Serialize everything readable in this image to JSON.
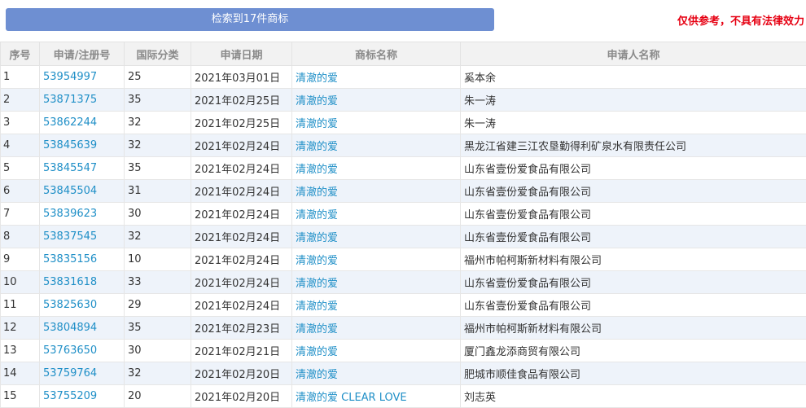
{
  "header": {
    "result_button_label": "检索到17件商标",
    "disclaimer": "仅供参考，不具有法律效力"
  },
  "table": {
    "columns": [
      "序号",
      "申请/注册号",
      "国际分类",
      "申请日期",
      "商标名称",
      "申请人名称"
    ],
    "rows": [
      {
        "no": "1",
        "reg_no": "53954997",
        "class": "25",
        "date": "2021年03月01日",
        "mark": "清澈的爱",
        "applicant": "奚本余"
      },
      {
        "no": "2",
        "reg_no": "53871375",
        "class": "35",
        "date": "2021年02月25日",
        "mark": "清澈的爱",
        "applicant": "朱一涛"
      },
      {
        "no": "3",
        "reg_no": "53862244",
        "class": "32",
        "date": "2021年02月25日",
        "mark": "清澈的爱",
        "applicant": "朱一涛"
      },
      {
        "no": "4",
        "reg_no": "53845639",
        "class": "32",
        "date": "2021年02月24日",
        "mark": "清澈的爱",
        "applicant": "黑龙江省建三江农垦勤得利矿泉水有限责任公司"
      },
      {
        "no": "5",
        "reg_no": "53845547",
        "class": "35",
        "date": "2021年02月24日",
        "mark": "清澈的爱",
        "applicant": "山东省壹份爱食品有限公司"
      },
      {
        "no": "6",
        "reg_no": "53845504",
        "class": "31",
        "date": "2021年02月24日",
        "mark": "清澈的爱",
        "applicant": "山东省壹份爱食品有限公司"
      },
      {
        "no": "7",
        "reg_no": "53839623",
        "class": "30",
        "date": "2021年02月24日",
        "mark": "清澈的爱",
        "applicant": "山东省壹份爱食品有限公司"
      },
      {
        "no": "8",
        "reg_no": "53837545",
        "class": "32",
        "date": "2021年02月24日",
        "mark": "清澈的爱",
        "applicant": "山东省壹份爱食品有限公司"
      },
      {
        "no": "9",
        "reg_no": "53835156",
        "class": "10",
        "date": "2021年02月24日",
        "mark": "清澈的爱",
        "applicant": "福州市帕柯斯新材料有限公司"
      },
      {
        "no": "10",
        "reg_no": "53831618",
        "class": "33",
        "date": "2021年02月24日",
        "mark": "清澈的爱",
        "applicant": "山东省壹份爱食品有限公司"
      },
      {
        "no": "11",
        "reg_no": "53825630",
        "class": "29",
        "date": "2021年02月24日",
        "mark": "清澈的爱",
        "applicant": "山东省壹份爱食品有限公司"
      },
      {
        "no": "12",
        "reg_no": "53804894",
        "class": "35",
        "date": "2021年02月23日",
        "mark": "清澈的爱",
        "applicant": "福州市帕柯斯新材料有限公司"
      },
      {
        "no": "13",
        "reg_no": "53763650",
        "class": "30",
        "date": "2021年02月21日",
        "mark": "清澈的爱",
        "applicant": "厦门鑫龙添商贸有限公司"
      },
      {
        "no": "14",
        "reg_no": "53759764",
        "class": "32",
        "date": "2021年02月20日",
        "mark": "清澈的爱",
        "applicant": "肥城市顺佳食品有限公司"
      },
      {
        "no": "15",
        "reg_no": "53755209",
        "class": "20",
        "date": "2021年02月20日",
        "mark": "清澈的爱 CLEAR LOVE",
        "applicant": "刘志英"
      }
    ]
  }
}
